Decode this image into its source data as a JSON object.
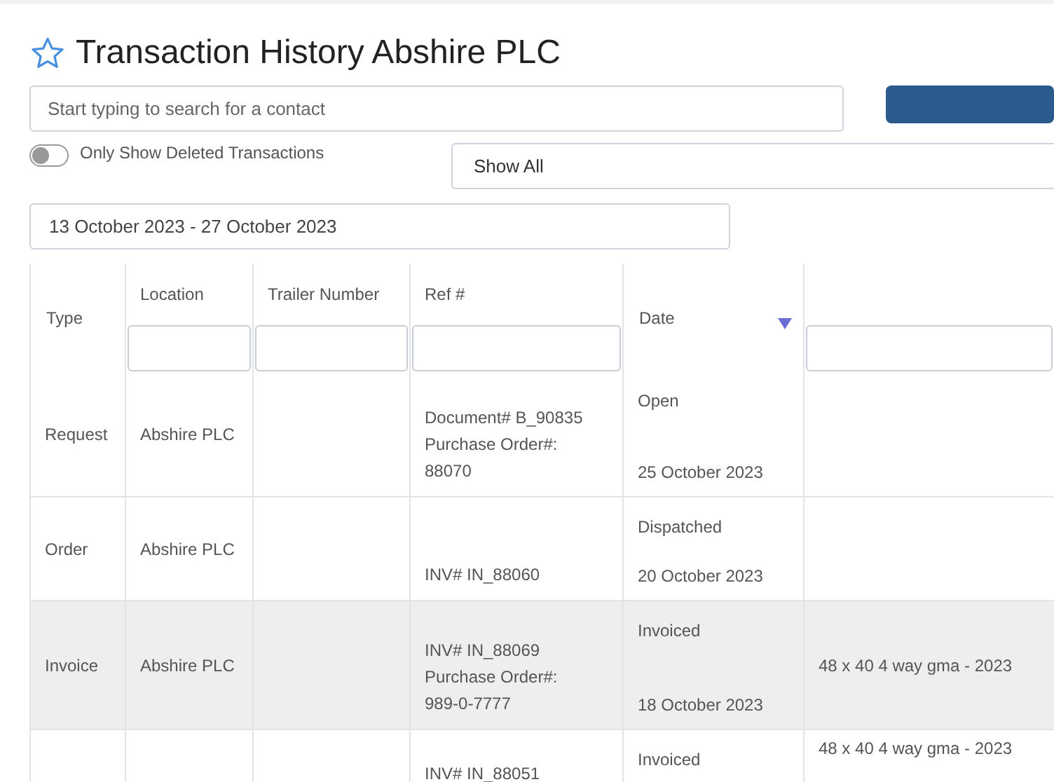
{
  "title": "Transaction History Abshire PLC",
  "favorite": false,
  "search": {
    "placeholder": "Start typing to search for a contact"
  },
  "toggle": {
    "label": "Only Show Deleted Transactions",
    "on": false
  },
  "filter_select": {
    "value": "Show All"
  },
  "date_range": {
    "value": "13 October 2023 - 27 October 2023"
  },
  "table": {
    "columns": [
      {
        "label": "Type",
        "filter": false
      },
      {
        "label": "Location",
        "filter": true
      },
      {
        "label": "Trailer Number",
        "filter": true
      },
      {
        "label": "Ref #",
        "filter": true
      },
      {
        "label": "Date",
        "filter": false,
        "sorted": true
      },
      {
        "filter": true
      }
    ],
    "rows": [
      {
        "selected": false,
        "type": "Request",
        "location": "Abshire PLC",
        "ref": [
          "Document# B_90835",
          "Purchase Order#:",
          "88070"
        ],
        "status": "Open",
        "date": "25 October 2023"
      },
      {
        "selected": false,
        "type": "Order",
        "location": "Abshire PLC",
        "ref": [
          "INV# IN_88060"
        ],
        "status": "Dispatched",
        "date": "20 October 2023"
      },
      {
        "selected": true,
        "type": "Invoice",
        "location": "Abshire PLC",
        "ref": [
          "INV# IN_88069",
          "Purchase Order#:",
          "989-0-7777"
        ],
        "status": "Invoiced",
        "date": "18 October 2023",
        "column_6": "48 x 40 4 way gma - 2023"
      },
      {
        "selected": false,
        "ref": [
          "INV# IN_88051"
        ],
        "status": "Invoiced",
        "column_6": "48 x 40 4 way gma - 2023"
      }
    ]
  }
}
